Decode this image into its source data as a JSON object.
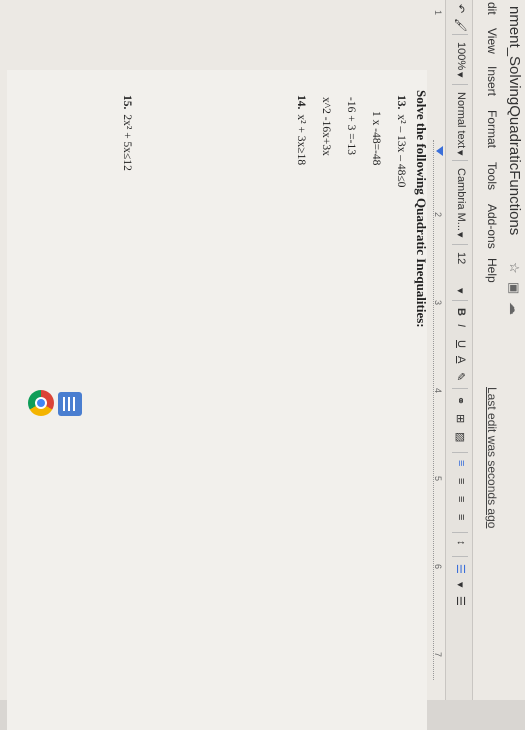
{
  "title": {
    "doc_title": "nment_SolvingQuadraticFunctions"
  },
  "menu": [
    {
      "label": "dit"
    },
    {
      "label": "View"
    },
    {
      "label": "Insert"
    },
    {
      "label": "Format"
    },
    {
      "label": "Tools"
    },
    {
      "label": "Add-ons"
    },
    {
      "label": "Help"
    }
  ],
  "last_edit": "Last edit was seconds ago",
  "toolbar": {
    "zoom": "100%",
    "style": "Normal text",
    "font": "Cambria M...",
    "font_size": "12",
    "bold": "B",
    "italic": "I",
    "underline": "U",
    "text_color": "A"
  },
  "ruler": {
    "marks": [
      "1",
      "2",
      "3",
      "4",
      "5",
      "6",
      "7"
    ]
  },
  "doc": {
    "heading": "Solve the following Quadratic Inequalities:",
    "lines": [
      {
        "num": "13.",
        "text": "x² – 13x – 48≤0"
      },
      {
        "num": "",
        "text": "1 x -48=-48"
      },
      {
        "num": "",
        "text": "-16 + 3 =-13"
      },
      {
        "num": "",
        "text": "x^2 -16x+3x"
      },
      {
        "num": "14.",
        "text": "x² + 3x≥18"
      },
      {
        "num": "15.",
        "text": "2x² + 5x≤12"
      }
    ]
  },
  "icons": [
    "star-icon",
    "folder-icon",
    "cloud-icon",
    "chrome-icon",
    "docs-app-icon"
  ]
}
